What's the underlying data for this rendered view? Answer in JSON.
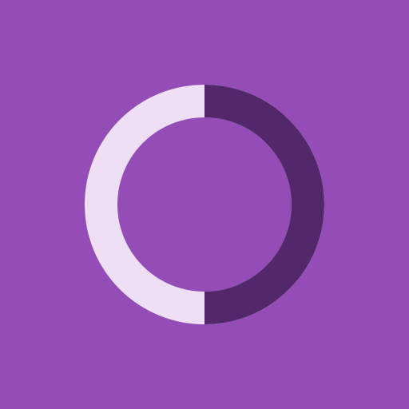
{
  "colors": {
    "background": "#944cb7",
    "track": "#eedff4",
    "progress": "#52286a"
  },
  "progress": {
    "fraction": 0.5,
    "direction": "clockwise-from-top"
  }
}
